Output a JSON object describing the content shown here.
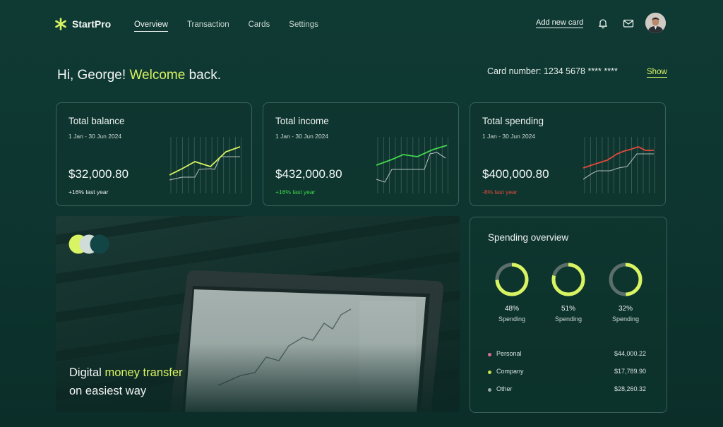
{
  "brand": {
    "name": "StartPro",
    "accent": "#d9f462"
  },
  "nav": {
    "links": [
      "Overview",
      "Transaction",
      "Cards",
      "Settings"
    ],
    "active": "Overview",
    "add_card": "Add new card"
  },
  "icons": {
    "notifications": "bell-icon",
    "messages": "mail-icon",
    "profile": "avatar"
  },
  "greeting": {
    "prefix": "Hi, George!",
    "accent": "Welcome",
    "suffix": "back."
  },
  "card": {
    "label": "Card number: 1234 5678 **** ****",
    "show": "Show"
  },
  "stats": [
    {
      "title": "Total balance",
      "range": "1 Jan - 30 Jun 2024",
      "value": "$32,000.80",
      "change": "+16% last year",
      "color": "#d9f462",
      "change_color": "#e8efec"
    },
    {
      "title": "Total income",
      "range": "1 Jan - 30 Jun 2024",
      "value": "$432,000.80",
      "change": "+16% last year",
      "color": "#43d74e",
      "change_color": "#43d74e"
    },
    {
      "title": "Total spending",
      "range": "1 Jan - 30 Jun 2024",
      "value": "$400,000.80",
      "change": "-8% last year",
      "color": "#e14a3c",
      "change_color": "#e14a3c"
    }
  ],
  "promo": {
    "line1_prefix": "Digital",
    "line1_accent": "money transfer",
    "line2": "on easiest way"
  },
  "overview": {
    "title": "Spending overview",
    "rings": [
      {
        "percent": "48%",
        "label": "Spending",
        "fraction": 0.48
      },
      {
        "percent": "51%",
        "label": "Spending",
        "fraction": 0.51
      },
      {
        "percent": "32%",
        "label": "Spending",
        "fraction": 0.32
      }
    ],
    "categories": [
      {
        "name": "Personal",
        "amount": "$44,000.22",
        "color": "#d96aa0"
      },
      {
        "name": "Company",
        "amount": "$17,789.90",
        "color": "#c9e04a"
      },
      {
        "name": "Other",
        "amount": "$28,260.32",
        "color": "#9aa8a4"
      }
    ]
  }
}
